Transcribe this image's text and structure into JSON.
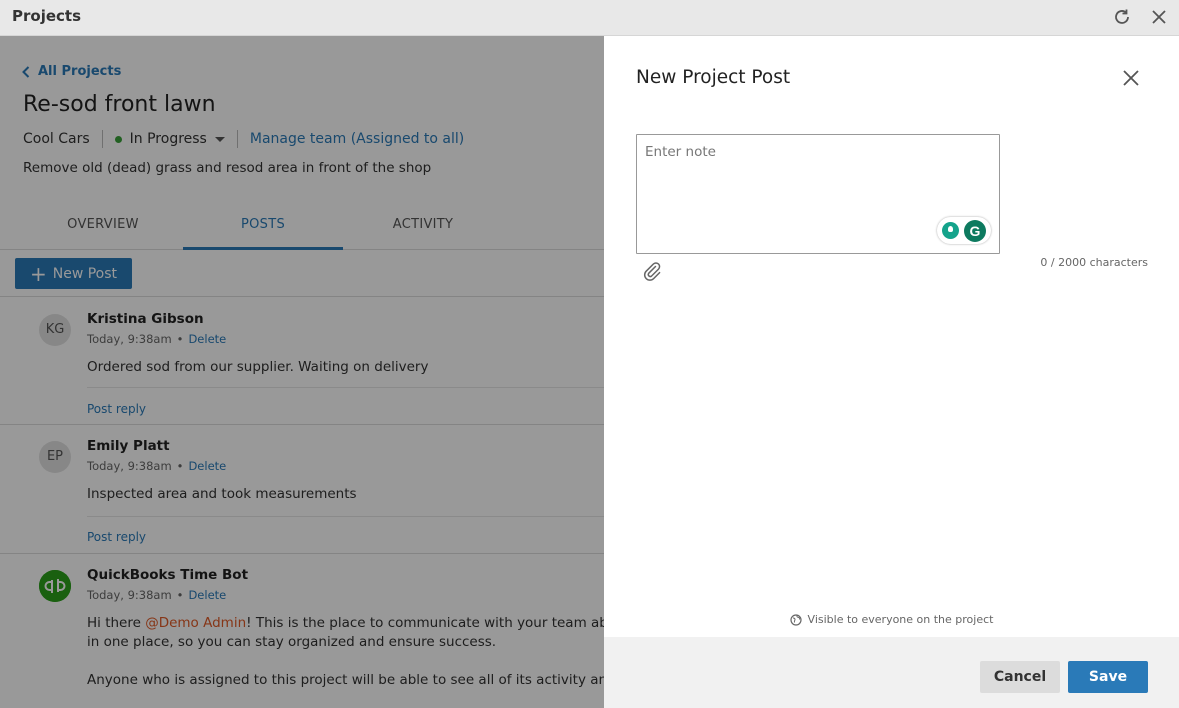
{
  "window": {
    "title": "Projects",
    "refresh_icon": "refresh-icon",
    "close_icon": "close-icon"
  },
  "project": {
    "back_label": "All Projects",
    "title": "Re-sod front lawn",
    "customer": "Cool Cars",
    "status": "In Progress",
    "status_color": "#3aa13a",
    "manage_team": "Manage team (Assigned to all)",
    "description": "Remove old (dead) grass and resod area in front of the shop"
  },
  "tabs": [
    {
      "label": "OVERVIEW",
      "active": false
    },
    {
      "label": "POSTS",
      "active": true
    },
    {
      "label": "ACTIVITY",
      "active": false
    }
  ],
  "new_post_label": "New Post",
  "posts": [
    {
      "initials": "KG",
      "author": "Kristina Gibson",
      "time": "Today, 9:38am",
      "delete": "Delete",
      "body": "Ordered sod from our supplier. Waiting on delivery",
      "reply": "Post reply"
    },
    {
      "initials": "EP",
      "author": "Emily Platt",
      "time": "Today, 9:38am",
      "delete": "Delete",
      "body": "Inspected area and took measurements",
      "reply": "Post reply"
    },
    {
      "initials": "qb",
      "author": "QuickBooks Time Bot",
      "time": "Today, 9:38am",
      "delete": "Delete",
      "body_prefix": "Hi there ",
      "mention": "@Demo Admin",
      "body_suffix": "! This is the place to communicate with your team about th",
      "body_line2": "in one place, so you can stay organized and ensure success.",
      "body_line3": "Anyone who is assigned to this project will be able to see all of its activity and post"
    }
  ],
  "drawer": {
    "title": "New Project Post",
    "note_placeholder": "Enter note",
    "char_count": "0 / 2000 characters",
    "visibility": "Visible to everyone on the project",
    "cancel_label": "Cancel",
    "save_label": "Save",
    "accent": "#2a7ab8"
  }
}
